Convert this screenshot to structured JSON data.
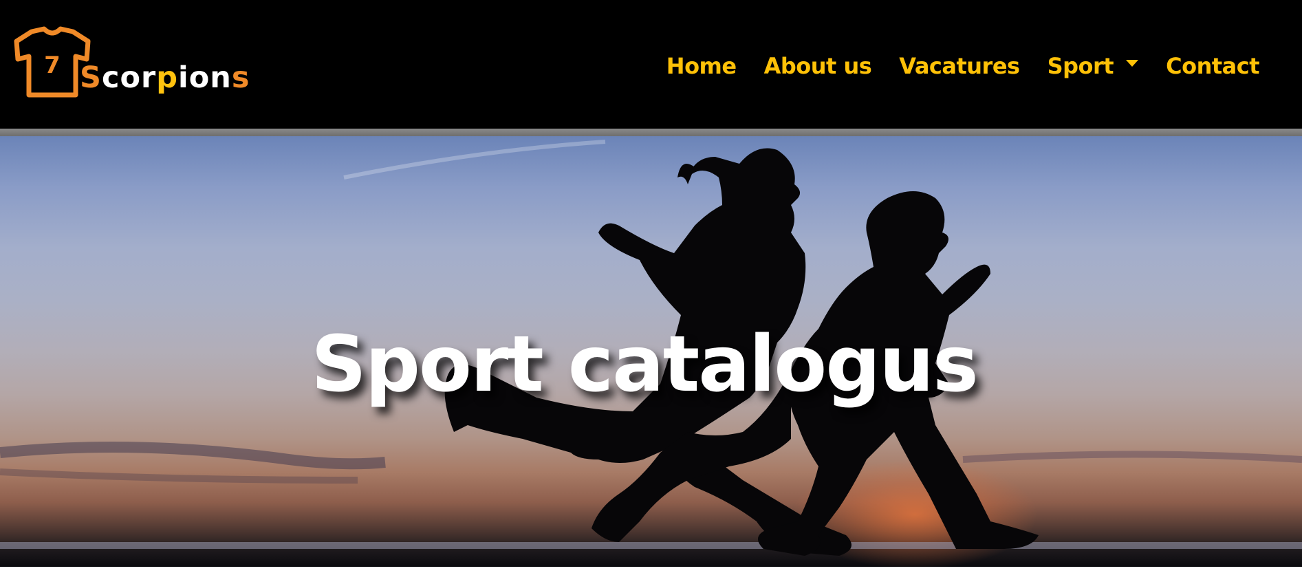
{
  "brand": {
    "name_parts": [
      {
        "text": "S",
        "tone": "orange"
      },
      {
        "text": "cor",
        "tone": "white"
      },
      {
        "text": "p",
        "tone": "yellow"
      },
      {
        "text": "ion",
        "tone": "white"
      },
      {
        "text": "s",
        "tone": "orange"
      }
    ],
    "logo_icon": "tshirt-icon",
    "logo_mark_text": "7",
    "colors": {
      "orange": "#f08a28",
      "yellow": "#ffc20e",
      "white": "#ffffff"
    }
  },
  "nav": {
    "items": [
      {
        "label": "Home",
        "dropdown": false
      },
      {
        "label": "About us",
        "dropdown": false
      },
      {
        "label": "Vacatures",
        "dropdown": false
      },
      {
        "label": "Sport",
        "dropdown": true
      },
      {
        "label": "Contact",
        "dropdown": false
      }
    ],
    "link_color": "#ffc107",
    "background": "#000000"
  },
  "hero": {
    "title": "Sport catalogus",
    "image_description_icon": "running-silhouettes-sunset-image"
  }
}
